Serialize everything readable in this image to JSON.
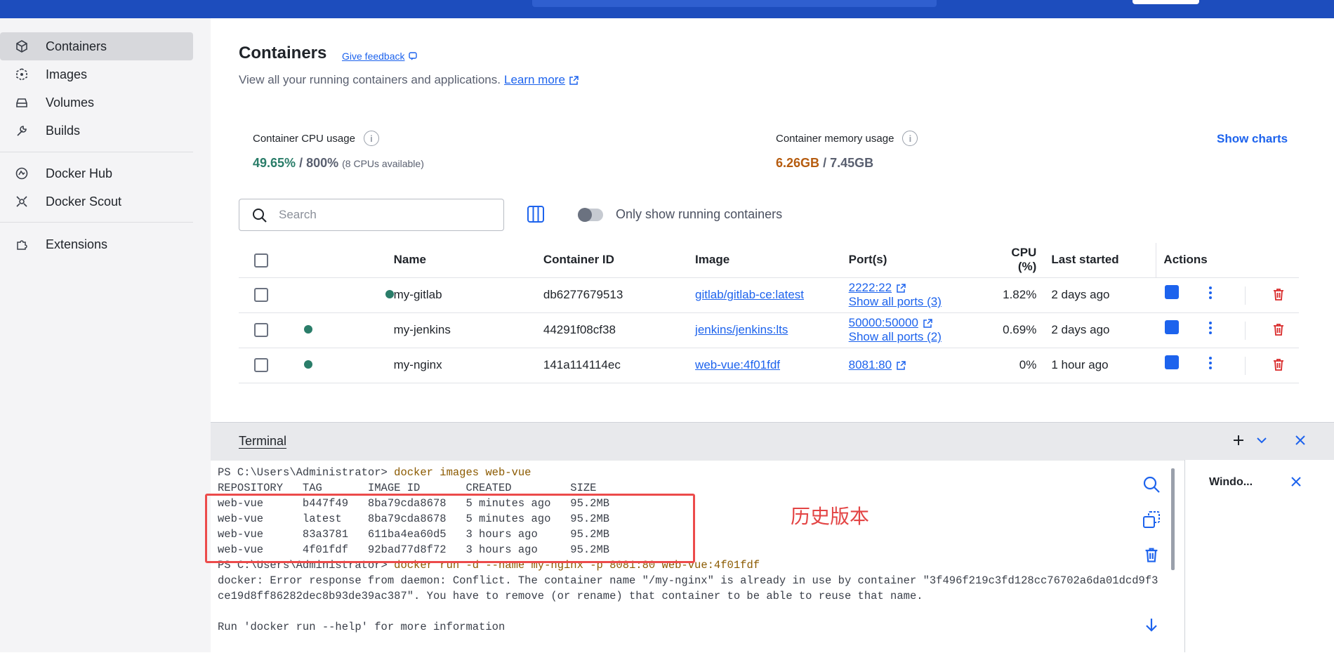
{
  "sidebar": {
    "items": [
      {
        "label": "Containers",
        "icon": "containers-icon"
      },
      {
        "label": "Images",
        "icon": "images-icon"
      },
      {
        "label": "Volumes",
        "icon": "volumes-icon"
      },
      {
        "label": "Builds",
        "icon": "builds-icon"
      },
      {
        "label": "Docker Hub",
        "icon": "docker-hub-icon"
      },
      {
        "label": "Docker Scout",
        "icon": "docker-scout-icon"
      },
      {
        "label": "Extensions",
        "icon": "extensions-icon"
      }
    ]
  },
  "header": {
    "title": "Containers",
    "feedback": "Give feedback",
    "subtitle": "View all your running containers and applications.",
    "learn_more": "Learn more"
  },
  "stats": {
    "cpu_label": "Container CPU usage",
    "cpu_value": "49.65%",
    "cpu_total": "/ 800%",
    "cpu_note": "(8 CPUs available)",
    "mem_label": "Container memory usage",
    "mem_value": "6.26GB",
    "mem_total": "/ 7.45GB",
    "show_charts": "Show charts",
    "cpu_color": "#2a7d69",
    "mem_color": "#b65c0f"
  },
  "toolbar": {
    "search_placeholder": "Search",
    "toggle_label": "Only show running containers"
  },
  "table": {
    "headers": [
      "Name",
      "Container ID",
      "Image",
      "Port(s)",
      "CPU (%)",
      "Last started",
      "Actions"
    ],
    "rows": [
      {
        "name": "my-gitlab",
        "id": "db6277679513",
        "image": "gitlab/gitlab-ce:latest",
        "port": "2222:22",
        "port_more": "Show all ports (3)",
        "cpu": "1.82%",
        "started": "2 days ago"
      },
      {
        "name": "my-jenkins",
        "id": "44291f08cf38",
        "image": "jenkins/jenkins:lts",
        "port": "50000:50000",
        "port_more": "Show all ports (2)",
        "cpu": "0.69%",
        "started": "2 days ago"
      },
      {
        "name": "my-nginx",
        "id": "141a114114ec",
        "image": "web-vue:4f01fdf",
        "port": "8081:80",
        "port_more": "",
        "cpu": "0%",
        "started": "1 hour ago"
      }
    ]
  },
  "terminal": {
    "tab": "Terminal",
    "lines": [
      {
        "prompt": "PS C:\\Users\\Administrator> ",
        "cmd": "docker images web-vue"
      },
      {
        "text": "REPOSITORY   TAG       IMAGE ID       CREATED         SIZE"
      },
      {
        "text": "web-vue      b447f49   8ba79cda8678   5 minutes ago   95.2MB"
      },
      {
        "text": "web-vue      latest    8ba79cda8678   5 minutes ago   95.2MB"
      },
      {
        "text": "web-vue      83a3781   611ba4ea60d5   3 hours ago     95.2MB"
      },
      {
        "text": "web-vue      4f01fdf   92bad77d8f72   3 hours ago     95.2MB"
      },
      {
        "prompt": "PS C:\\Users\\Administrator> ",
        "cmd": "docker run -d --name my-nginx -p 8081:80 web-vue:4f01fdf"
      },
      {
        "text": "docker: Error response from daemon: Conflict. The container name \"/my-nginx\" is already in use by container \"3f496f219c3fd128cc76702a6da01dcd9f3"
      },
      {
        "text": "ce19d8ff86282dec8b93de39ac387\". You have to remove (or rename) that container to be able to reuse that name."
      },
      {
        "text": ""
      },
      {
        "text": "Run 'docker run --help' for more information"
      }
    ],
    "annotation": "历史版本",
    "side_panel_label": "Windo..."
  }
}
